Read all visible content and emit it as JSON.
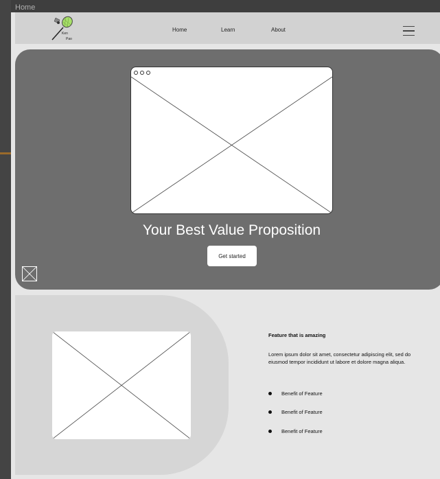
{
  "page": {
    "frame_label": "Home"
  },
  "nav": {
    "logo_line1": "Ken",
    "logo_line2": "Pao",
    "links": [
      "Home",
      "Learn",
      "About"
    ]
  },
  "hero": {
    "title": "Your Best Value Proposition",
    "cta_label": "Get started"
  },
  "feature": {
    "title": "Feature that is amazing",
    "description": "Lorem ipsum dolor sit amet, consectetur adipiscing elit, sed do eiusmod tempor incididunt ut labore et dolore magna aliqua.",
    "benefits": [
      "Benefit of Feature",
      "Benefit of Feature",
      "Benefit of Feature"
    ]
  },
  "colors": {
    "hero_bg": "#6e6e6e",
    "navbar_bg": "#d2d2d2",
    "page_bg": "#e6e6e6",
    "accent": "#a8e06a"
  },
  "icons": [
    "badminton-logo-icon",
    "hamburger-menu-icon",
    "image-placeholder-icon"
  ]
}
